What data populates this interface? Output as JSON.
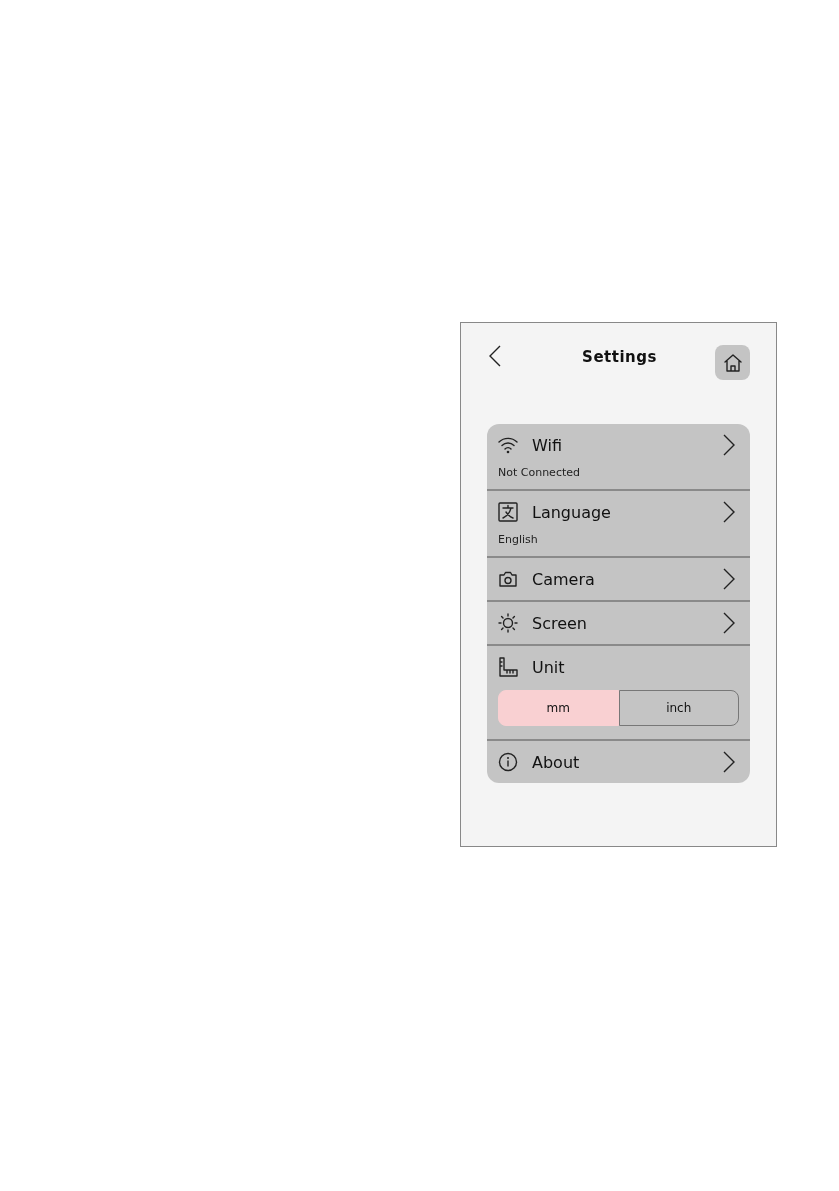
{
  "header": {
    "title": "Settings"
  },
  "items": [
    {
      "kind": "nav",
      "label": "Wifi",
      "value": "Not Connected"
    },
    {
      "kind": "nav",
      "label": "Language",
      "value": "English"
    },
    {
      "kind": "nav",
      "label": "Camera"
    },
    {
      "kind": "nav",
      "label": "Screen"
    },
    {
      "kind": "segmented",
      "label": "Unit",
      "options": [
        {
          "label": "mm",
          "selected": true
        },
        {
          "label": "inch",
          "selected": false
        }
      ]
    },
    {
      "kind": "nav",
      "label": "About"
    }
  ]
}
